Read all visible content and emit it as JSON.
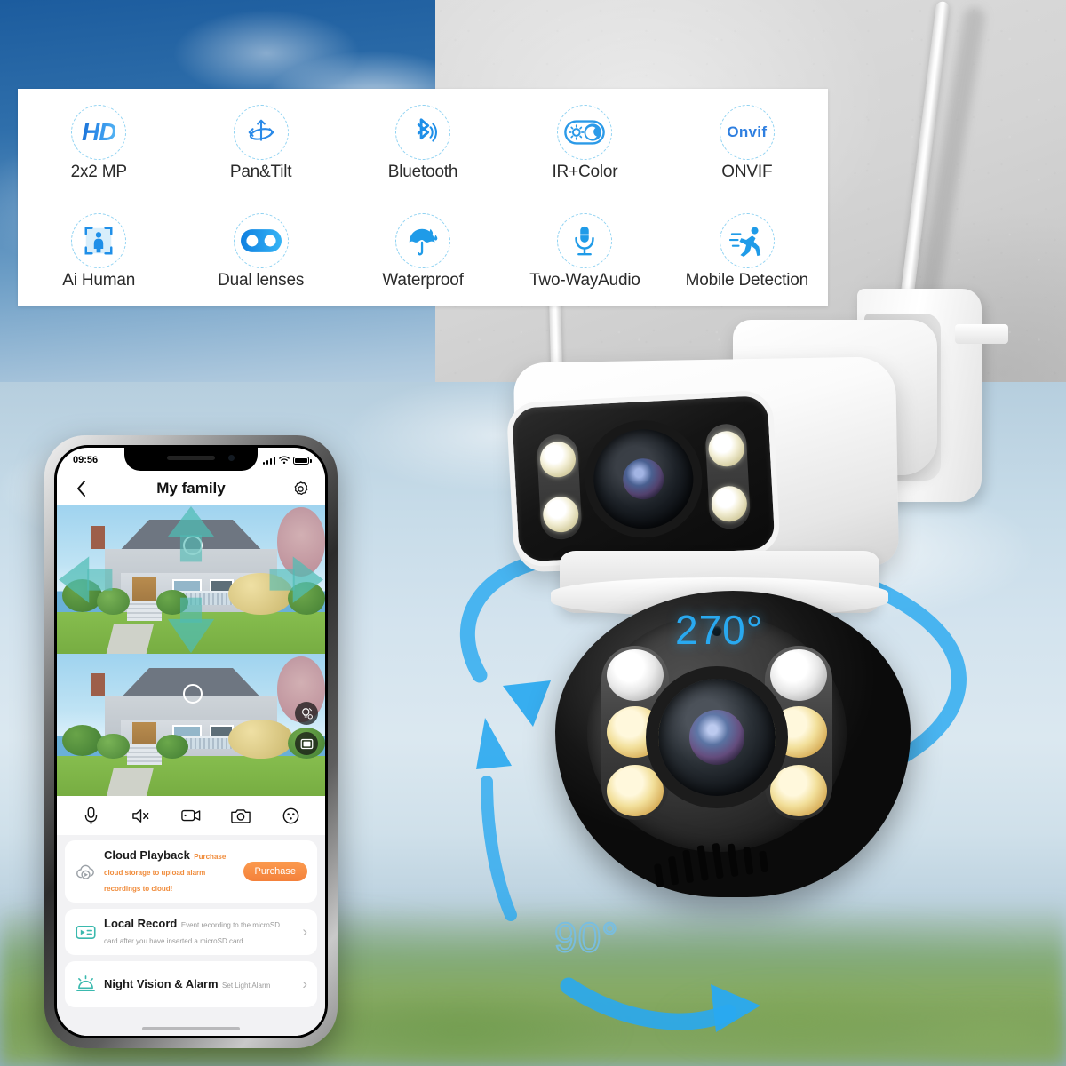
{
  "features": {
    "row1": [
      {
        "label": "2x2 MP",
        "icon": "hd-icon",
        "glyph": "HD"
      },
      {
        "label": "Pan&Tilt",
        "icon": "pan-tilt-icon",
        "glyph": ""
      },
      {
        "label": "Bluetooth",
        "icon": "bluetooth-icon",
        "glyph": ""
      },
      {
        "label": "IR+Color",
        "icon": "ir-color-toggle-icon",
        "glyph": ""
      },
      {
        "label": "ONVIF",
        "icon": "onvif-icon",
        "glyph": "Onvif"
      }
    ],
    "row2": [
      {
        "label": "Ai Human",
        "icon": "ai-human-icon",
        "glyph": ""
      },
      {
        "label": "Dual lenses",
        "icon": "dual-lenses-icon",
        "glyph": ""
      },
      {
        "label": "Waterproof",
        "icon": "umbrella-waterproof-icon",
        "glyph": ""
      },
      {
        "label": "Two-WayAudio",
        "icon": "microphone-icon",
        "glyph": ""
      },
      {
        "label": "Mobile Detection",
        "icon": "running-person-icon",
        "glyph": ""
      }
    ]
  },
  "rotation": {
    "pan_label": "270°",
    "tilt_label": "90°",
    "arrow_color": "#29a9f0"
  },
  "phone": {
    "status": {
      "time": "09:56",
      "signal_icon": "cellular-signal-icon",
      "wifi_icon": "wifi-icon",
      "battery_icon": "battery-full-icon"
    },
    "nav": {
      "back_icon": "chevron-left-icon",
      "title": "My family",
      "settings_icon": "gear-icon"
    },
    "video_overlay_buttons": [
      {
        "name": "light-control-icon"
      },
      {
        "name": "screen-layout-icon"
      }
    ],
    "toolbar": [
      {
        "name": "microphone-icon",
        "label": "Talk"
      },
      {
        "name": "speaker-mute-icon",
        "label": "Mute"
      },
      {
        "name": "video-record-icon",
        "label": "Record"
      },
      {
        "name": "camera-snapshot-icon",
        "label": "Snapshot"
      },
      {
        "name": "more-options-icon",
        "label": "More"
      }
    ],
    "list": [
      {
        "icon": "cloud-play-icon",
        "title": "Cloud Playback",
        "subtitle": "Purchase cloud storage to upload alarm recordings to cloud!",
        "subtitle_style": "orange",
        "action_label": "Purchase",
        "action_type": "button",
        "accent": "#f4813b"
      },
      {
        "icon": "local-record-icon",
        "title": "Local Record",
        "subtitle": "Event recording to the microSD card after you have inserted a microSD card",
        "subtitle_style": "grey",
        "action_label": "›",
        "action_type": "chevron",
        "accent": "#3ab9ae"
      },
      {
        "icon": "night-vision-alarm-icon",
        "title": "Night Vision & Alarm",
        "subtitle": "Set Light Alarm",
        "subtitle_style": "grey",
        "action_label": "›",
        "action_type": "chevron",
        "accent": "#3ab9ae"
      }
    ]
  }
}
